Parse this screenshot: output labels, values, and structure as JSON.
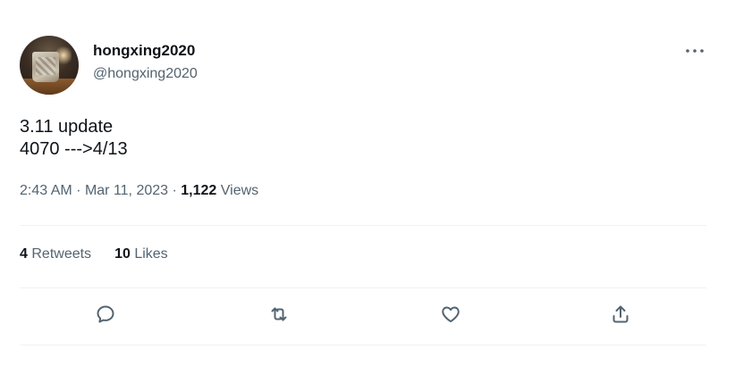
{
  "user": {
    "display_name": "hongxing2020",
    "handle": "@hongxing2020"
  },
  "tweet": {
    "lines": [
      "3.11 update",
      "4070 --->4/13"
    ]
  },
  "meta": {
    "time": "2:43 AM",
    "separator": "·",
    "date": "Mar 11, 2023",
    "views_count": "1,122",
    "views_label": "Views"
  },
  "stats": {
    "retweets_count": "4",
    "retweets_label": "Retweets",
    "likes_count": "10",
    "likes_label": "Likes"
  },
  "icons": {
    "more": "more-icon",
    "reply": "reply-icon",
    "retweet": "retweet-icon",
    "like": "heart-icon",
    "share": "share-icon"
  },
  "colors": {
    "text_primary": "#0f1419",
    "text_secondary": "#536471",
    "divider": "#eff3f4"
  }
}
